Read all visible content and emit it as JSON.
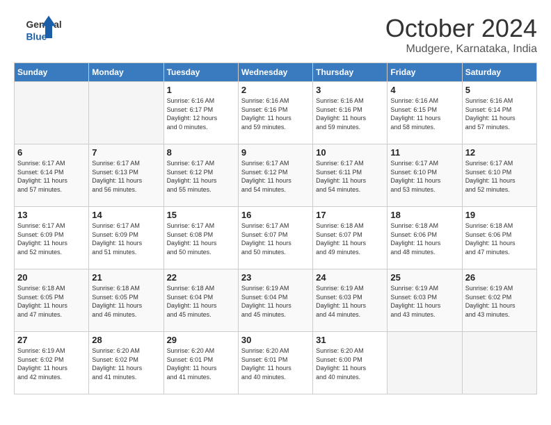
{
  "header": {
    "logo_line1": "General",
    "logo_line2": "Blue",
    "month": "October 2024",
    "location": "Mudgere, Karnataka, India"
  },
  "days_of_week": [
    "Sunday",
    "Monday",
    "Tuesday",
    "Wednesday",
    "Thursday",
    "Friday",
    "Saturday"
  ],
  "weeks": [
    [
      {
        "day": "",
        "info": ""
      },
      {
        "day": "",
        "info": ""
      },
      {
        "day": "1",
        "info": "Sunrise: 6:16 AM\nSunset: 6:17 PM\nDaylight: 12 hours\nand 0 minutes."
      },
      {
        "day": "2",
        "info": "Sunrise: 6:16 AM\nSunset: 6:16 PM\nDaylight: 11 hours\nand 59 minutes."
      },
      {
        "day": "3",
        "info": "Sunrise: 6:16 AM\nSunset: 6:16 PM\nDaylight: 11 hours\nand 59 minutes."
      },
      {
        "day": "4",
        "info": "Sunrise: 6:16 AM\nSunset: 6:15 PM\nDaylight: 11 hours\nand 58 minutes."
      },
      {
        "day": "5",
        "info": "Sunrise: 6:16 AM\nSunset: 6:14 PM\nDaylight: 11 hours\nand 57 minutes."
      }
    ],
    [
      {
        "day": "6",
        "info": "Sunrise: 6:17 AM\nSunset: 6:14 PM\nDaylight: 11 hours\nand 57 minutes."
      },
      {
        "day": "7",
        "info": "Sunrise: 6:17 AM\nSunset: 6:13 PM\nDaylight: 11 hours\nand 56 minutes."
      },
      {
        "day": "8",
        "info": "Sunrise: 6:17 AM\nSunset: 6:12 PM\nDaylight: 11 hours\nand 55 minutes."
      },
      {
        "day": "9",
        "info": "Sunrise: 6:17 AM\nSunset: 6:12 PM\nDaylight: 11 hours\nand 54 minutes."
      },
      {
        "day": "10",
        "info": "Sunrise: 6:17 AM\nSunset: 6:11 PM\nDaylight: 11 hours\nand 54 minutes."
      },
      {
        "day": "11",
        "info": "Sunrise: 6:17 AM\nSunset: 6:10 PM\nDaylight: 11 hours\nand 53 minutes."
      },
      {
        "day": "12",
        "info": "Sunrise: 6:17 AM\nSunset: 6:10 PM\nDaylight: 11 hours\nand 52 minutes."
      }
    ],
    [
      {
        "day": "13",
        "info": "Sunrise: 6:17 AM\nSunset: 6:09 PM\nDaylight: 11 hours\nand 52 minutes."
      },
      {
        "day": "14",
        "info": "Sunrise: 6:17 AM\nSunset: 6:09 PM\nDaylight: 11 hours\nand 51 minutes."
      },
      {
        "day": "15",
        "info": "Sunrise: 6:17 AM\nSunset: 6:08 PM\nDaylight: 11 hours\nand 50 minutes."
      },
      {
        "day": "16",
        "info": "Sunrise: 6:17 AM\nSunset: 6:07 PM\nDaylight: 11 hours\nand 50 minutes."
      },
      {
        "day": "17",
        "info": "Sunrise: 6:18 AM\nSunset: 6:07 PM\nDaylight: 11 hours\nand 49 minutes."
      },
      {
        "day": "18",
        "info": "Sunrise: 6:18 AM\nSunset: 6:06 PM\nDaylight: 11 hours\nand 48 minutes."
      },
      {
        "day": "19",
        "info": "Sunrise: 6:18 AM\nSunset: 6:06 PM\nDaylight: 11 hours\nand 47 minutes."
      }
    ],
    [
      {
        "day": "20",
        "info": "Sunrise: 6:18 AM\nSunset: 6:05 PM\nDaylight: 11 hours\nand 47 minutes."
      },
      {
        "day": "21",
        "info": "Sunrise: 6:18 AM\nSunset: 6:05 PM\nDaylight: 11 hours\nand 46 minutes."
      },
      {
        "day": "22",
        "info": "Sunrise: 6:18 AM\nSunset: 6:04 PM\nDaylight: 11 hours\nand 45 minutes."
      },
      {
        "day": "23",
        "info": "Sunrise: 6:19 AM\nSunset: 6:04 PM\nDaylight: 11 hours\nand 45 minutes."
      },
      {
        "day": "24",
        "info": "Sunrise: 6:19 AM\nSunset: 6:03 PM\nDaylight: 11 hours\nand 44 minutes."
      },
      {
        "day": "25",
        "info": "Sunrise: 6:19 AM\nSunset: 6:03 PM\nDaylight: 11 hours\nand 43 minutes."
      },
      {
        "day": "26",
        "info": "Sunrise: 6:19 AM\nSunset: 6:02 PM\nDaylight: 11 hours\nand 43 minutes."
      }
    ],
    [
      {
        "day": "27",
        "info": "Sunrise: 6:19 AM\nSunset: 6:02 PM\nDaylight: 11 hours\nand 42 minutes."
      },
      {
        "day": "28",
        "info": "Sunrise: 6:20 AM\nSunset: 6:02 PM\nDaylight: 11 hours\nand 41 minutes."
      },
      {
        "day": "29",
        "info": "Sunrise: 6:20 AM\nSunset: 6:01 PM\nDaylight: 11 hours\nand 41 minutes."
      },
      {
        "day": "30",
        "info": "Sunrise: 6:20 AM\nSunset: 6:01 PM\nDaylight: 11 hours\nand 40 minutes."
      },
      {
        "day": "31",
        "info": "Sunrise: 6:20 AM\nSunset: 6:00 PM\nDaylight: 11 hours\nand 40 minutes."
      },
      {
        "day": "",
        "info": ""
      },
      {
        "day": "",
        "info": ""
      }
    ]
  ]
}
